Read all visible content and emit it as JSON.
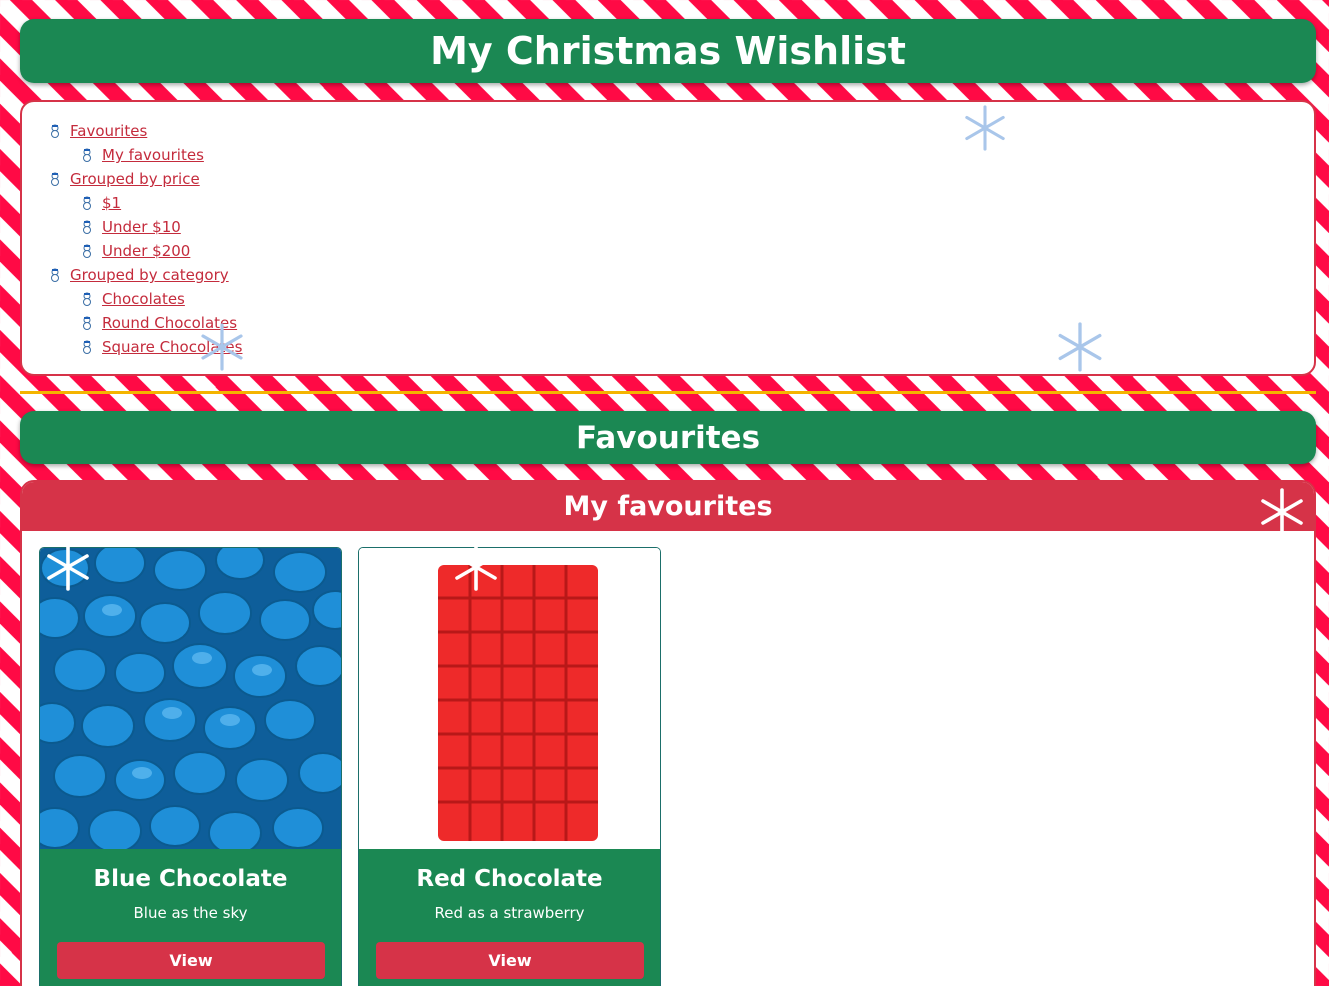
{
  "page_title": "My Christmas Wishlist",
  "nav": {
    "items": [
      {
        "label": "Favourites",
        "level": 1
      },
      {
        "label": "My favourites",
        "level": 2
      },
      {
        "label": "Grouped by price",
        "level": 1
      },
      {
        "label": "$1",
        "level": 2
      },
      {
        "label": "Under $10",
        "level": 2
      },
      {
        "label": "Under $200",
        "level": 2
      },
      {
        "label": "Grouped by category",
        "level": 1
      },
      {
        "label": "Chocolates",
        "level": 2
      },
      {
        "label": "Round Chocolates",
        "level": 2
      },
      {
        "label": "Square Chocolates",
        "level": 2
      }
    ]
  },
  "section": {
    "title": "Favourites",
    "panel_title": "My favourites"
  },
  "cards": [
    {
      "title": "Blue Chocolate",
      "description": "Blue as the sky",
      "button_label": "View",
      "image": "blue-candies-image"
    },
    {
      "title": "Red Chocolate",
      "description": "Red as a strawberry",
      "button_label": "View",
      "image": "red-chocolate-bar-image"
    }
  ],
  "colors": {
    "green": "#1b8853",
    "red": "#d63348",
    "stripe_red": "#ff0a45",
    "divider_gold": "#f4b400",
    "link_red": "#c42b3c"
  },
  "icons": [
    "snowman-bullet-icon",
    "snowflake-icon"
  ]
}
